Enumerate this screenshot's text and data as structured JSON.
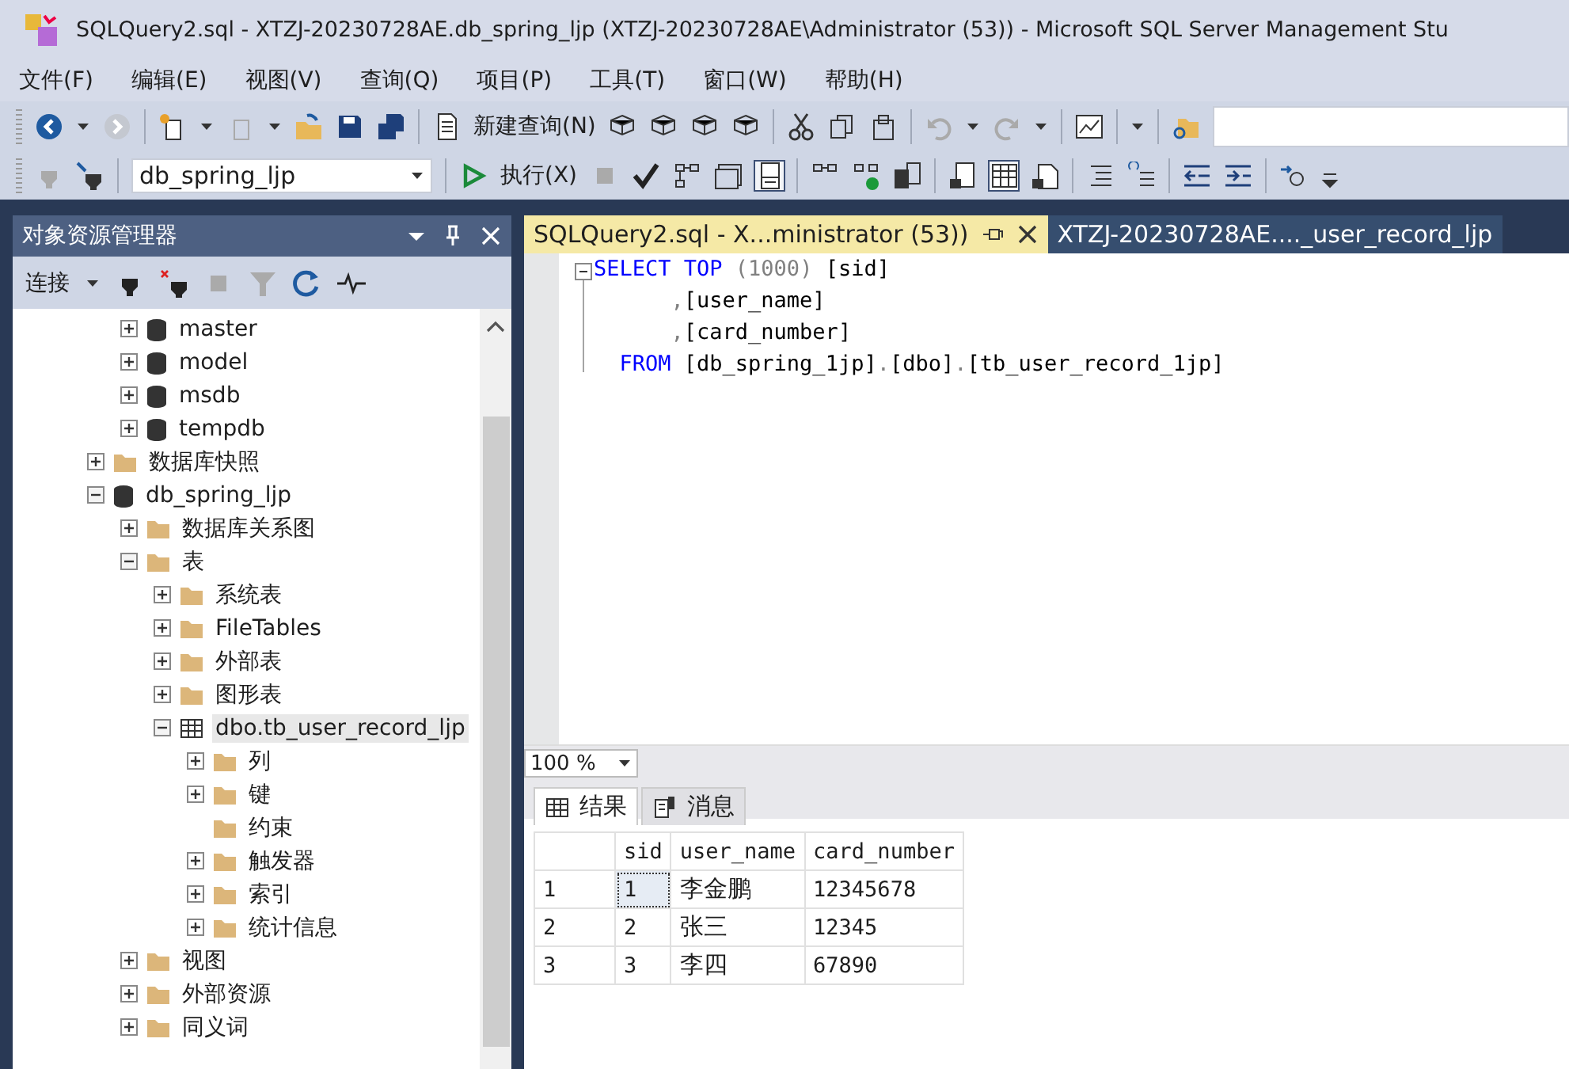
{
  "window": {
    "title": "SQLQuery2.sql - XTZJ-20230728AE.db_spring_ljp (XTZJ-20230728AE\\Administrator (53)) - Microsoft SQL Server Management Stu"
  },
  "menu": [
    "文件(F)",
    "编辑(E)",
    "视图(V)",
    "查询(Q)",
    "项目(P)",
    "工具(T)",
    "窗口(W)",
    "帮助(H)"
  ],
  "toolbar_1": {
    "new_query": "新建查询(N)"
  },
  "toolbar_2": {
    "database": "db_spring_ljp",
    "execute": "执行(X)",
    "show_results_pane": true,
    "results_to_grid": true
  },
  "object_explorer": {
    "title": "对象资源管理器",
    "connect": "连接",
    "tree": {
      "items_continued": [
        {
          "label": "master",
          "kind": "database",
          "expanded": false,
          "selected": false
        },
        {
          "label": "model",
          "kind": "database",
          "expanded": false,
          "selected": false
        },
        {
          "label": "msdb",
          "kind": "database",
          "expanded": false,
          "selected": false
        },
        {
          "label": "tempdb",
          "kind": "database",
          "expanded": false,
          "selected": false
        }
      ],
      "items": [
        {
          "label": "数据库快照",
          "kind": "folder",
          "expanded": false,
          "selected": false
        },
        {
          "label": "db_spring_ljp",
          "kind": "database",
          "expanded": true,
          "selected": false,
          "children": [
            {
              "label": "数据库关系图",
              "kind": "folder",
              "expanded": false,
              "selected": false
            },
            {
              "label": "表",
              "kind": "folder",
              "expanded": true,
              "selected": false,
              "children": [
                {
                  "label": "系统表",
                  "kind": "folder",
                  "expanded": false,
                  "selected": false
                },
                {
                  "label": "FileTables",
                  "kind": "folder",
                  "expanded": false,
                  "selected": false
                },
                {
                  "label": "外部表",
                  "kind": "folder",
                  "expanded": false,
                  "selected": false
                },
                {
                  "label": "图形表",
                  "kind": "folder",
                  "expanded": false,
                  "selected": false
                },
                {
                  "label": "dbo.tb_user_record_ljp",
                  "kind": "table",
                  "expanded": true,
                  "selected": true,
                  "children": [
                    {
                      "label": "列",
                      "kind": "folder",
                      "expanded": false,
                      "selected": false
                    },
                    {
                      "label": "键",
                      "kind": "folder",
                      "expanded": false,
                      "selected": false
                    },
                    {
                      "label": "约束",
                      "kind": "folder",
                      "selected": false
                    },
                    {
                      "label": "触发器",
                      "kind": "folder",
                      "expanded": false,
                      "selected": false
                    },
                    {
                      "label": "索引",
                      "kind": "folder",
                      "expanded": false,
                      "selected": false
                    },
                    {
                      "label": "统计信息",
                      "kind": "folder",
                      "expanded": false,
                      "selected": false
                    }
                  ]
                }
              ]
            },
            {
              "label": "视图",
              "kind": "folder",
              "expanded": false,
              "selected": false
            },
            {
              "label": "外部资源",
              "kind": "folder",
              "expanded": false,
              "selected": false
            },
            {
              "label": "同义词",
              "kind": "folder",
              "expanded": false,
              "selected": false
            }
          ]
        }
      ]
    }
  },
  "document_tabs": [
    {
      "label": "SQLQuery2.sql - X...ministrator (53))",
      "selected": true
    },
    {
      "label": "XTZJ-20230728AE...._user_record_ljp",
      "selected": false
    }
  ],
  "editor": {
    "lines": [
      [
        {
          "text": "SELECT",
          "kind": "keyword"
        },
        {
          "text": " TOP",
          "kind": "keyword"
        },
        {
          "text": " (1000) ",
          "kind": "punct"
        },
        {
          "text": "[sid]",
          "kind": "plain"
        }
      ],
      [
        {
          "text": "      ,",
          "kind": "punct"
        },
        {
          "text": "[user_name]",
          "kind": "plain"
        }
      ],
      [
        {
          "text": "      ,",
          "kind": "punct"
        },
        {
          "text": "[card_number]",
          "kind": "plain"
        }
      ],
      [
        {
          "text": "  FROM",
          "kind": "keyword"
        },
        {
          "text": " [db_spring_1jp]",
          "kind": "plain"
        },
        {
          "text": ".",
          "kind": "punct"
        },
        {
          "text": "[dbo]",
          "kind": "plain"
        },
        {
          "text": ".",
          "kind": "punct"
        },
        {
          "text": "[tb_user_record_1jp]",
          "kind": "plain"
        }
      ]
    ],
    "zoom": "100 %"
  },
  "result_tabs": [
    {
      "label": "结果",
      "kind": "grid",
      "selected": true
    },
    {
      "label": "消息",
      "kind": "messages",
      "selected": false
    }
  ],
  "results": {
    "columns": [
      "sid",
      "user_name",
      "card_number"
    ],
    "rows": [
      {
        "number": "1",
        "cells": [
          "1",
          "李金鹏",
          "12345678"
        ],
        "selected": true
      },
      {
        "number": "2",
        "cells": [
          "2",
          "张三",
          "12345"
        ],
        "selected": false
      },
      {
        "number": "3",
        "cells": [
          "3",
          "李四",
          "67890"
        ],
        "selected": false
      }
    ]
  }
}
